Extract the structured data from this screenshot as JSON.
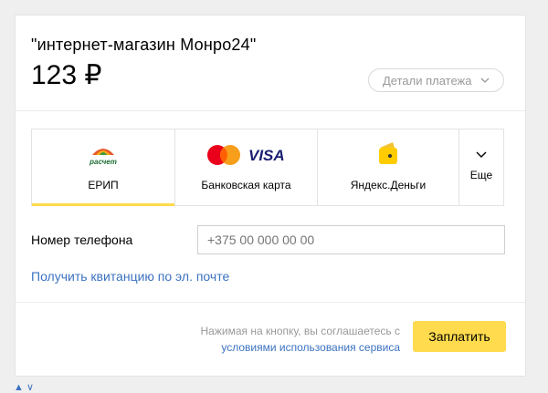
{
  "payment": {
    "merchant": "\"интернет-магазин Монро24\"",
    "amount": "123 ₽",
    "details_label": "Детали платежа"
  },
  "tabs": [
    {
      "label": "ЕРИП",
      "icon": "raschet-logo-icon",
      "active": true
    },
    {
      "label": "Банковская карта",
      "icon": "mastercard-visa-icon"
    },
    {
      "label": "Яндекс.Деньги",
      "icon": "yandex-money-wallet-icon"
    },
    {
      "label": "Еще",
      "icon": "chevron-down-icon"
    }
  ],
  "logo_text": {
    "raschet": "расчет",
    "visa": "VISA"
  },
  "form": {
    "phone_label": "Номер телефона",
    "phone_placeholder": "+375 00 000 00 00",
    "receipt_link": "Получить квитанцию по эл. почте"
  },
  "footer": {
    "terms_text": "Нажимая на кнопку, вы соглашаетесь с",
    "terms_link": "условиями использования сервиса",
    "pay_label": "Заплатить"
  },
  "colors": {
    "accent": "#ffdb4d",
    "link": "#3c72c0",
    "muted": "#999999"
  }
}
